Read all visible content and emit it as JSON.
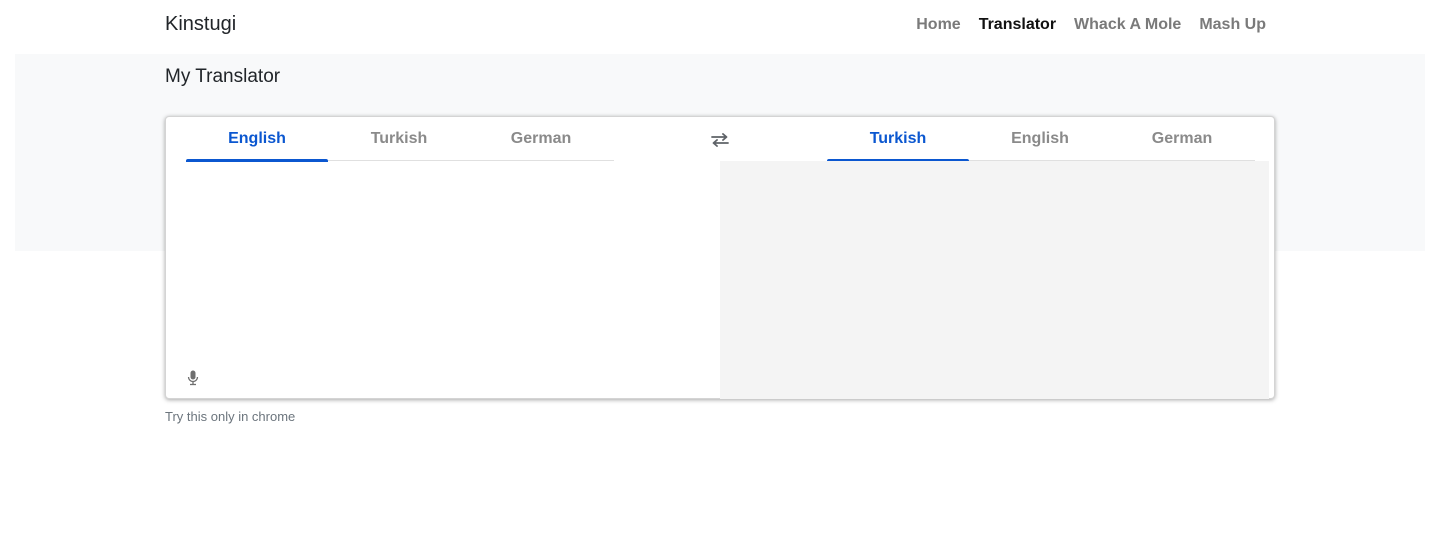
{
  "navbar": {
    "brand": "Kinstugi",
    "links": [
      {
        "label": "Home",
        "active": false
      },
      {
        "label": "Translator",
        "active": true
      },
      {
        "label": "Whack A Mole",
        "active": false
      },
      {
        "label": "Mash Up",
        "active": false
      }
    ]
  },
  "page": {
    "title": "My Translator"
  },
  "translator": {
    "source_tabs": [
      {
        "label": "English",
        "active": true
      },
      {
        "label": "Turkish",
        "active": false
      },
      {
        "label": "German",
        "active": false
      }
    ],
    "target_tabs": [
      {
        "label": "Turkish",
        "active": true
      },
      {
        "label": "English",
        "active": false
      },
      {
        "label": "German",
        "active": false
      }
    ],
    "swap_icon": "swap-arrows-icon",
    "mic_icon": "microphone-icon",
    "source_text": "",
    "output_text": ""
  },
  "footer": {
    "hint": "Try this only in chrome"
  },
  "colors": {
    "accent": "#0b57d0",
    "banner": "#f8f9fa",
    "output_bg": "#f4f4f4",
    "inactive_tab": "#8a8a8a"
  }
}
